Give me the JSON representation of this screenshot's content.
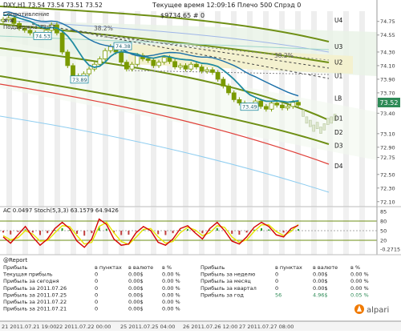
{
  "header": {
    "symbol_line": "DXY,H1  73.54 73.54 73.51 73.52",
    "status_line": "Текущее время 12:09:16 Плечо 500 Спрэд 0",
    "balance_line": "$9734.65  # 0",
    "left_annotations": [
      "Сопротивление",
      "# #",
      "Поддержка 73.77"
    ]
  },
  "chart_data": [
    {
      "type": "line",
      "title": "DXY,H1",
      "y_axis_ticks": [
        74.75,
        74.55,
        74.3,
        74.1,
        73.9,
        73.7,
        73.52,
        73.4,
        73.1,
        72.9,
        72.75,
        72.5,
        72.3,
        72.1
      ],
      "ylim": [
        72.05,
        74.9
      ],
      "level_labels": [
        {
          "name": "U4",
          "value": 74.77
        },
        {
          "name": "U3",
          "value": 74.38
        },
        {
          "name": "U2",
          "value": 74.15
        },
        {
          "name": "U1",
          "value": 73.95
        },
        {
          "name": "LB",
          "value": 73.62
        },
        {
          "name": "D1",
          "value": 73.33
        },
        {
          "name": "D2",
          "value": 73.12
        },
        {
          "name": "D3",
          "value": 72.93
        },
        {
          "name": "D4",
          "value": 72.63
        }
      ],
      "price_marks": [
        {
          "label": "74.53",
          "value": 74.53
        },
        {
          "label": "74.38",
          "value": 74.38
        },
        {
          "label": "73.89",
          "value": 73.89
        },
        {
          "label": "73.49",
          "value": 73.49
        }
      ],
      "annotations": [
        "38.2%",
        "38.2%"
      ],
      "current_price": "73.52",
      "series": [
        {
          "name": "DXY",
          "values": [
            74.78,
            74.8,
            74.72,
            74.65,
            74.62,
            74.58,
            74.53,
            74.55,
            74.62,
            74.7,
            74.58,
            74.3,
            74.1,
            73.95,
            73.89,
            73.98,
            74.05,
            74.12,
            74.2,
            74.32,
            74.38,
            74.3,
            74.15,
            74.05,
            74.12,
            74.25,
            74.2,
            74.18,
            74.1,
            74.15,
            74.22,
            74.16,
            74.08,
            74.1,
            74.05,
            74.12,
            74.08,
            74.02,
            74.04,
            74.0,
            73.9,
            73.8,
            73.7,
            73.6,
            73.55,
            73.49,
            73.52,
            73.58,
            73.5,
            73.46,
            73.55,
            73.52,
            73.48,
            73.5,
            73.56,
            73.52
          ]
        }
      ]
    },
    {
      "type": "line",
      "title": "AC 0.0497  Stoch(5,3,3) 63.1579 64.9426",
      "y_axis_ticks": [
        85,
        80,
        50,
        20,
        -0.2715
      ],
      "ylim": [
        0,
        100
      ],
      "series": [
        {
          "name": "Stoch main",
          "values": [
            35,
            20,
            40,
            60,
            35,
            15,
            30,
            55,
            70,
            55,
            25,
            10,
            30,
            78,
            65,
            30,
            15,
            18,
            45,
            60,
            50,
            22,
            15,
            30,
            55,
            62,
            45,
            30,
            55,
            70,
            50,
            25,
            18,
            35,
            58,
            70,
            60,
            40,
            35,
            55,
            63
          ]
        },
        {
          "name": "Stoch signal",
          "values": [
            38,
            28,
            33,
            50,
            42,
            25,
            26,
            45,
            62,
            60,
            38,
            18,
            22,
            60,
            70,
            45,
            24,
            17,
            34,
            53,
            55,
            35,
            20,
            24,
            45,
            58,
            52,
            38,
            45,
            62,
            58,
            35,
            22,
            28,
            48,
            64,
            64,
            48,
            38,
            48,
            65
          ]
        }
      ]
    }
  ],
  "report": {
    "title": "@Report",
    "left_columns": [
      "в пунктах",
      "в валюте",
      "в %"
    ],
    "right_columns": [
      "в пунктах",
      "в валюте",
      "в %"
    ],
    "left_rows": [
      {
        "label": "Прибыль",
        "points": "",
        "money": "",
        "pct": ""
      },
      {
        "label": "Текущая прибыль",
        "points": "0",
        "money": "0.00$",
        "pct": "0.00 %"
      },
      {
        "label": "Прибыль за сегодня",
        "points": "0",
        "money": "0.00$",
        "pct": "0.00 %"
      },
      {
        "label": "Прибыль за 2011.07.26",
        "points": "0",
        "money": "0.00$",
        "pct": "0.00 %"
      },
      {
        "label": "Прибыль за 2011.07.25",
        "points": "0",
        "money": "0.00$",
        "pct": "0.00 %"
      },
      {
        "label": "Прибыль за 2011.07.22",
        "points": "0",
        "money": "0.00$",
        "pct": "0.00 %"
      },
      {
        "label": "Прибыль за 2011.07.21",
        "points": "0",
        "money": "0.00$",
        "pct": "0.00 %"
      }
    ],
    "right_rows": [
      {
        "label": "Прибыль",
        "points": "",
        "money": "",
        "pct": ""
      },
      {
        "label": "Прибыль за неделю",
        "points": "0",
        "money": "0.00$",
        "pct": "0.00 %"
      },
      {
        "label": "Прибыль за месяц",
        "points": "0",
        "money": "0.00$",
        "pct": "0.00 %"
      },
      {
        "label": "Прибыль за квартал",
        "points": "0",
        "money": "0.00$",
        "pct": "0.00 %"
      },
      {
        "label": "Прибыль за год",
        "points": "56",
        "money": "4.96$",
        "pct": "0.05 %"
      }
    ]
  },
  "x_axis_labels": [
    "21 2011.07.21 19:00",
    "22 2011.07.22 00:00",
    "25 2011.07.25 04:00",
    "26 2011.07.26 12:00",
    "27 2011.07.27 08:00"
  ],
  "logo": {
    "text": "alpari"
  },
  "colors": {
    "background": "#ffffff",
    "candle": "#7a9a00",
    "fast_ma": "#1f8aa0",
    "channel": "#6e8f14",
    "envelope_red": "#e0403a",
    "stoch_main": "#d40000",
    "stoch_signal": "#e6e600",
    "logo": "#f07a00"
  }
}
